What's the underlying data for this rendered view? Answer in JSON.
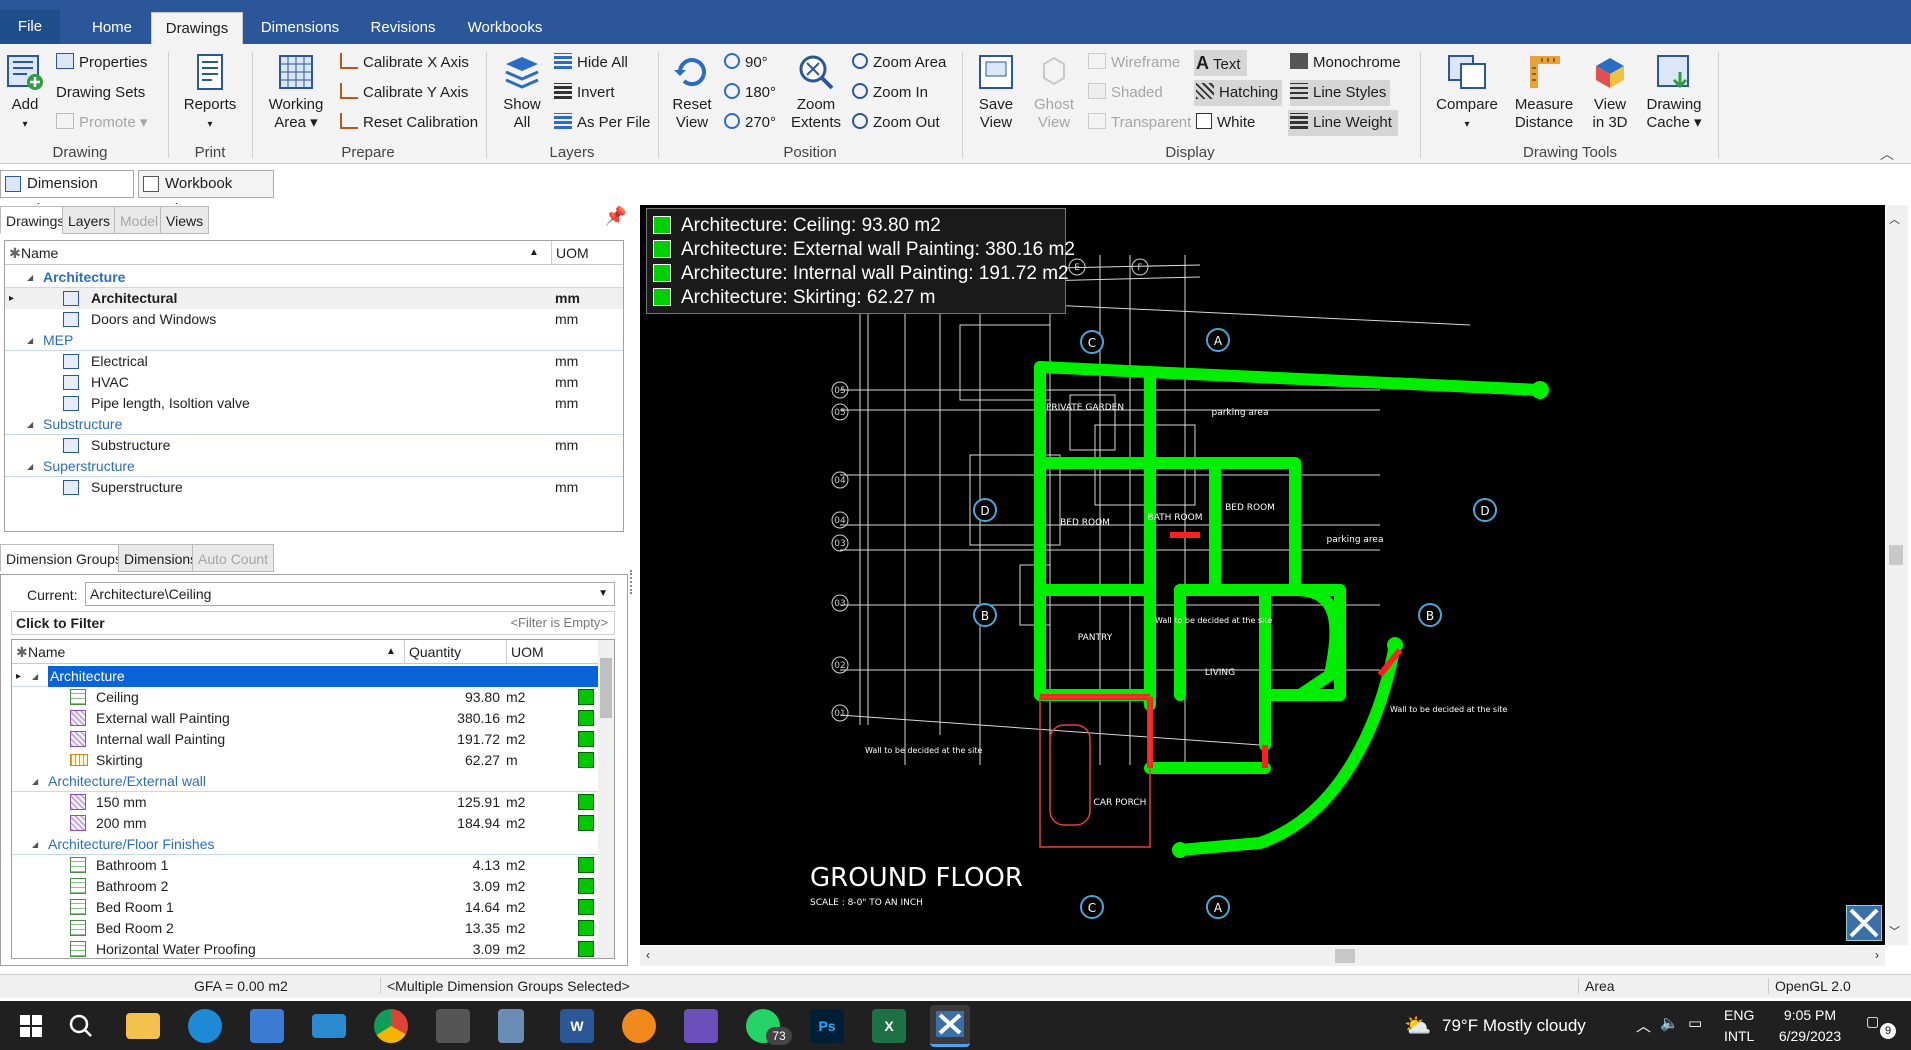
{
  "menu": {
    "file": "File",
    "tabs": [
      "Home",
      "Drawings",
      "Dimensions",
      "Revisions",
      "Workbooks"
    ]
  },
  "ribbon": {
    "drawing": {
      "add": "Add",
      "properties": "Properties",
      "drawing_sets": "Drawing Sets",
      "promote": "Promote",
      "group": "Drawing"
    },
    "print": {
      "reports": "Reports",
      "group": "Print"
    },
    "prepare": {
      "working_area_1": "Working",
      "working_area_2": "Area",
      "calibrate_x": "Calibrate X Axis",
      "calibrate_y": "Calibrate Y Axis",
      "reset_calibration": "Reset Calibration",
      "group": "Prepare"
    },
    "layers": {
      "show_all_1": "Show",
      "show_all_2": "All",
      "hide_all": "Hide All",
      "invert": "Invert",
      "as_per_file": "As Per File",
      "group": "Layers"
    },
    "position": {
      "reset_view_1": "Reset",
      "reset_view_2": "View",
      "rot90": "90°",
      "rot180": "180°",
      "rot270": "270°",
      "zoom_extents_1": "Zoom",
      "zoom_extents_2": "Extents",
      "zoom_area": "Zoom Area",
      "zoom_in": "Zoom In",
      "zoom_out": "Zoom Out",
      "group": "Position"
    },
    "display": {
      "save_view_1": "Save",
      "save_view_2": "View",
      "ghost_view_1": "Ghost",
      "ghost_view_2": "View",
      "wireframe": "Wireframe",
      "shaded": "Shaded",
      "transparent": "Transparent",
      "text": "Text",
      "hatching": "Hatching",
      "white": "White",
      "monochrome": "Monochrome",
      "line_styles": "Line Styles",
      "line_weight": "Line Weight",
      "group": "Display"
    },
    "tools": {
      "compare": "Compare",
      "measure_1": "Measure",
      "measure_2": "Distance",
      "view3d_1": "View",
      "view3d_2": "in 3D",
      "cache_1": "Drawing",
      "cache_2": "Cache",
      "group": "Drawing Tools"
    }
  },
  "viewtabs": [
    "Dimension View",
    "Workbook View"
  ],
  "drawings_panel": {
    "tabs": [
      "Drawings",
      "Layers",
      "Model",
      "Views"
    ],
    "col_name": "Name",
    "col_uom": "UOM",
    "rows": [
      {
        "type": "cat",
        "label": "Architecture"
      },
      {
        "type": "item",
        "label": "Architectural",
        "uom": "mm",
        "bold": true
      },
      {
        "type": "item",
        "label": "Doors and Windows",
        "uom": "mm"
      },
      {
        "type": "cat",
        "label": "MEP"
      },
      {
        "type": "item",
        "label": "Electrical",
        "uom": "mm"
      },
      {
        "type": "item",
        "label": "HVAC",
        "uom": "mm"
      },
      {
        "type": "item",
        "label": "Pipe length, Isoltion valve",
        "uom": "mm"
      },
      {
        "type": "cat",
        "label": "Substructure"
      },
      {
        "type": "item",
        "label": "Substructure",
        "uom": "mm"
      },
      {
        "type": "cat",
        "label": "Superstructure"
      },
      {
        "type": "item",
        "label": "Superstructure",
        "uom": "mm"
      }
    ]
  },
  "dim_panel": {
    "tabs": [
      "Dimension Groups",
      "Dimensions",
      "Auto Count"
    ],
    "current_label": "Current:",
    "current_value": "Architecture\\Ceiling",
    "click_filter": "Click to Filter",
    "filter_empty": "<Filter is Empty>",
    "col_name": "Name",
    "col_qty": "Quantity",
    "col_uom": "UOM",
    "rows": [
      {
        "type": "cat",
        "label": "Architecture",
        "selected": true
      },
      {
        "type": "item",
        "icon": "grid",
        "label": "Ceiling",
        "qty": "93.80",
        "uom": "m2"
      },
      {
        "type": "item",
        "icon": "hatch",
        "label": "External wall Painting",
        "qty": "380.16",
        "uom": "m2"
      },
      {
        "type": "item",
        "icon": "hatch",
        "label": "Internal wall Painting",
        "qty": "191.72",
        "uom": "m2"
      },
      {
        "type": "item",
        "icon": "ruler",
        "label": "Skirting",
        "qty": "62.27",
        "uom": "m"
      },
      {
        "type": "cat",
        "label": "Architecture/External wall"
      },
      {
        "type": "item",
        "icon": "hatch",
        "label": "150 mm",
        "qty": "125.91",
        "uom": "m2"
      },
      {
        "type": "item",
        "icon": "hatch",
        "label": "200 mm",
        "qty": "184.94",
        "uom": "m2"
      },
      {
        "type": "cat",
        "label": "Architecture/Floor Finishes"
      },
      {
        "type": "item",
        "icon": "grid",
        "label": "Bathroom 1",
        "qty": "4.13",
        "uom": "m2"
      },
      {
        "type": "item",
        "icon": "grid",
        "label": "Bathroom 2",
        "qty": "3.09",
        "uom": "m2"
      },
      {
        "type": "item",
        "icon": "grid",
        "label": "Bed Room 1",
        "qty": "14.64",
        "uom": "m2"
      },
      {
        "type": "item",
        "icon": "grid",
        "label": "Bed Room 2",
        "qty": "13.35",
        "uom": "m2"
      },
      {
        "type": "item",
        "icon": "grid",
        "label": "Horizontal Water Proofing",
        "qty": "3.09",
        "uom": "m2"
      }
    ]
  },
  "canvas": {
    "legend": [
      "Architecture: Ceiling: 93.80 m2",
      "Architecture: External wall Painting: 380.16 m2",
      "Architecture: Internal wall Painting: 191.72 m2",
      "Architecture: Skirting: 62.27 m"
    ],
    "plan_title": "GROUND FLOOR",
    "plan_scale": "SCALE : 8-0\" TO AN INCH",
    "rooms": [
      "PRIVATE GARDEN",
      "BED ROOM",
      "BATH ROOM",
      "BED ROOM",
      "PANTRY",
      "LIVING",
      "CAR PORCH",
      "parking area",
      "parking area"
    ],
    "notes": [
      "Wall to be decided at the site",
      "Wall to be decided at the site",
      "Wall to be decided at the site"
    ],
    "grid_letters": [
      "B",
      "C",
      "D",
      "E",
      "F"
    ],
    "grid_numbers": [
      "06",
      "05",
      "05",
      "04",
      "04",
      "03",
      "03",
      "02",
      "01"
    ],
    "section_marks": [
      "C",
      "A",
      "D",
      "D",
      "B",
      "B",
      "C",
      "A"
    ]
  },
  "status": {
    "gfa": "GFA = 0.00 m2",
    "selection": "<Multiple Dimension Groups Selected>",
    "mode": "Area",
    "renderer": "OpenGL 2.0"
  },
  "taskbar": {
    "whatsapp_badge": "73",
    "weather": "79°F  Mostly cloudy",
    "lang1": "ENG",
    "lang2": "INTL",
    "time": "9:05 PM",
    "date": "6/29/2023",
    "notif": "9"
  },
  "colors": {
    "accent": "#2b579a",
    "measure_green": "#00ff00",
    "measure_red": "#ff2020",
    "canvas_bg": "#000000"
  }
}
